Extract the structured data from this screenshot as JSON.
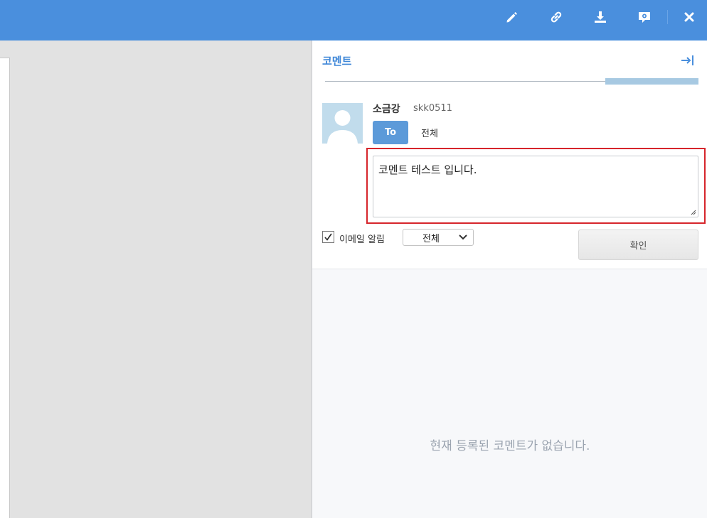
{
  "toolbar": {
    "icons": [
      "pencil-icon",
      "link-icon",
      "download-icon",
      "comment-settings-icon",
      "close-icon"
    ],
    "accent": "#4a8fdd"
  },
  "comment_panel": {
    "title": "코멘트",
    "author": {
      "name": "소금강",
      "id": "skk0511"
    },
    "to_label": "To",
    "to_target": "전체",
    "comment_text": "코멘트 테스트 입니다.",
    "email_notify": {
      "label": "이메일 알림",
      "checked": true
    },
    "recipient_select": {
      "value": "전체"
    },
    "confirm_label": "확인",
    "empty_message": "현재 등록된 코멘트가 없습니다.",
    "highlight_color": "#d6252b"
  }
}
